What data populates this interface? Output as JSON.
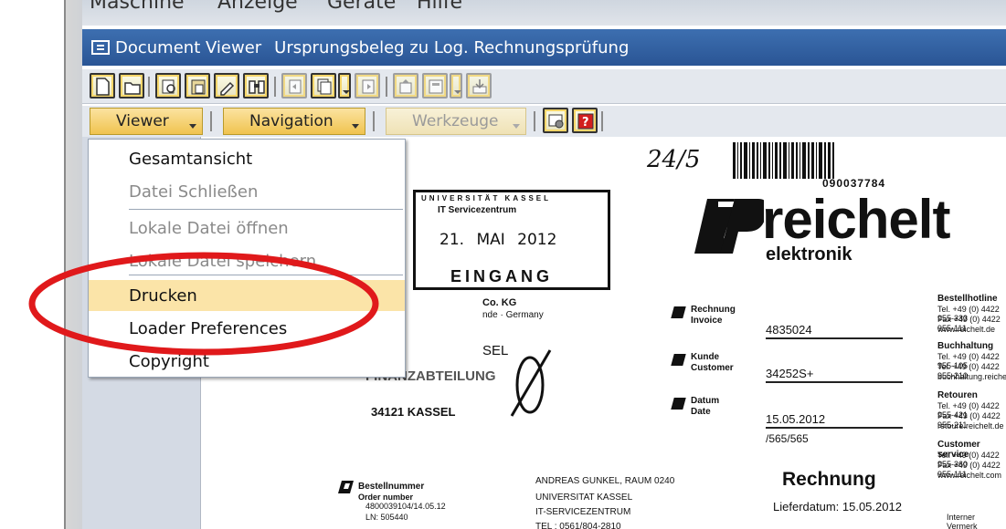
{
  "menubar": {
    "items": [
      "Maschine",
      "Anzeige",
      "Geräte",
      "Hilfe"
    ]
  },
  "window": {
    "app_name": "Document Viewer",
    "title": "Ursprungsbeleg zu Log. Rechnungsprüfung"
  },
  "button_row": {
    "viewer": "Viewer",
    "navigation": "Navigation",
    "werkzeuge": "Werkzeuge"
  },
  "viewer_menu": {
    "items": [
      {
        "label": "Gesamtansicht",
        "enabled": true
      },
      {
        "label": "Datei Schließen",
        "enabled": false
      },
      {
        "label": "Lokale Datei öffnen",
        "enabled": false
      },
      {
        "label": "Lokale Datei speichern",
        "enabled": false
      },
      {
        "label": "Drucken",
        "enabled": true,
        "highlighted": true
      },
      {
        "label": "Loader Preferences",
        "enabled": true
      },
      {
        "label": "Copyright",
        "enabled": true
      }
    ]
  },
  "annotation": {
    "color": "#e0191b",
    "target": "Drucken"
  },
  "document": {
    "handwritten_number": "24/5",
    "barcode_number": "090037784",
    "stamp": {
      "header": "UNIVERSITÄT KASSEL",
      "dept": "IT Servicezentrum",
      "date": "21. MAI 2012",
      "footer": "EINGANG"
    },
    "logo": {
      "name": "reichelt",
      "sub": "elektronik"
    },
    "sender": {
      "line1": "Co. KG",
      "line2": "nde · Germany"
    },
    "recipient": {
      "line1": "SEL",
      "line2": "FINANZABTEILUNG",
      "city": "34121 KASSEL"
    },
    "fields": [
      {
        "label_de": "Rechnung",
        "label_en": "Invoice",
        "value": "4835024"
      },
      {
        "label_de": "Kunde",
        "label_en": "Customer",
        "value": "34252S+"
      },
      {
        "label_de": "Datum",
        "label_en": "Date",
        "value": "15.05.2012",
        "extra": "/565/565"
      }
    ],
    "contacts": [
      {
        "heading": "Bestellhotline",
        "lines": [
          "Tel. +49 (0) 4422 955-333",
          "Fax +49 (0) 4422 955-111",
          "www.reichelt.de"
        ]
      },
      {
        "heading": "Buchhaltung",
        "lines": [
          "Tel. +49 (0) 4422 955-105",
          "Tel. +49 (0) 4422 955-210",
          "buchhaltung.reichelt.de"
        ]
      },
      {
        "heading": "Retouren",
        "lines": [
          "Tel. +49 (0) 4422 955-421",
          "Fax +49 (0) 4422 955-211",
          "retoure.reichelt.de"
        ]
      },
      {
        "heading": "Customer service",
        "lines": [
          "Tel. +49 (0) 4422 955-360",
          "Fax +49 (0) 4422 955-111",
          "www.reichelt.com"
        ]
      }
    ],
    "order": {
      "label_de": "Bestellnummer",
      "label_en": "Order number",
      "value": "4800039104/14.05.12",
      "ln": "LN: 505440"
    },
    "address": [
      "ANDREAS GUNKEL, RAUM 0240",
      "UNIVERSITAT KASSEL",
      "IT-SERVICEZENTRUM",
      "TEL : 0561/804-2810"
    ],
    "heading": "Rechnung",
    "lieferdatum": "Lieferdatum: 15.05.2012",
    "internal": "Interner Vermerk"
  }
}
